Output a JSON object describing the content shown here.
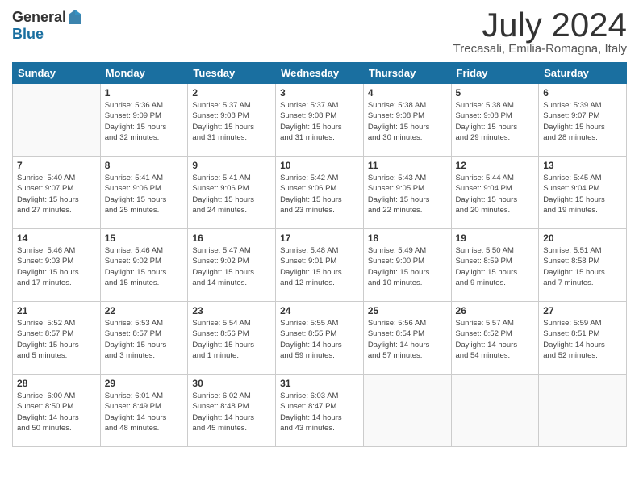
{
  "logo": {
    "general": "General",
    "blue": "Blue"
  },
  "title": "July 2024",
  "subtitle": "Trecasali, Emilia-Romagna, Italy",
  "days": [
    "Sunday",
    "Monday",
    "Tuesday",
    "Wednesday",
    "Thursday",
    "Friday",
    "Saturday"
  ],
  "weeks": [
    [
      {
        "num": "",
        "info": ""
      },
      {
        "num": "1",
        "info": "Sunrise: 5:36 AM\nSunset: 9:09 PM\nDaylight: 15 hours\nand 32 minutes."
      },
      {
        "num": "2",
        "info": "Sunrise: 5:37 AM\nSunset: 9:08 PM\nDaylight: 15 hours\nand 31 minutes."
      },
      {
        "num": "3",
        "info": "Sunrise: 5:37 AM\nSunset: 9:08 PM\nDaylight: 15 hours\nand 31 minutes."
      },
      {
        "num": "4",
        "info": "Sunrise: 5:38 AM\nSunset: 9:08 PM\nDaylight: 15 hours\nand 30 minutes."
      },
      {
        "num": "5",
        "info": "Sunrise: 5:38 AM\nSunset: 9:08 PM\nDaylight: 15 hours\nand 29 minutes."
      },
      {
        "num": "6",
        "info": "Sunrise: 5:39 AM\nSunset: 9:07 PM\nDaylight: 15 hours\nand 28 minutes."
      }
    ],
    [
      {
        "num": "7",
        "info": "Sunrise: 5:40 AM\nSunset: 9:07 PM\nDaylight: 15 hours\nand 27 minutes."
      },
      {
        "num": "8",
        "info": "Sunrise: 5:41 AM\nSunset: 9:06 PM\nDaylight: 15 hours\nand 25 minutes."
      },
      {
        "num": "9",
        "info": "Sunrise: 5:41 AM\nSunset: 9:06 PM\nDaylight: 15 hours\nand 24 minutes."
      },
      {
        "num": "10",
        "info": "Sunrise: 5:42 AM\nSunset: 9:06 PM\nDaylight: 15 hours\nand 23 minutes."
      },
      {
        "num": "11",
        "info": "Sunrise: 5:43 AM\nSunset: 9:05 PM\nDaylight: 15 hours\nand 22 minutes."
      },
      {
        "num": "12",
        "info": "Sunrise: 5:44 AM\nSunset: 9:04 PM\nDaylight: 15 hours\nand 20 minutes."
      },
      {
        "num": "13",
        "info": "Sunrise: 5:45 AM\nSunset: 9:04 PM\nDaylight: 15 hours\nand 19 minutes."
      }
    ],
    [
      {
        "num": "14",
        "info": "Sunrise: 5:46 AM\nSunset: 9:03 PM\nDaylight: 15 hours\nand 17 minutes."
      },
      {
        "num": "15",
        "info": "Sunrise: 5:46 AM\nSunset: 9:02 PM\nDaylight: 15 hours\nand 15 minutes."
      },
      {
        "num": "16",
        "info": "Sunrise: 5:47 AM\nSunset: 9:02 PM\nDaylight: 15 hours\nand 14 minutes."
      },
      {
        "num": "17",
        "info": "Sunrise: 5:48 AM\nSunset: 9:01 PM\nDaylight: 15 hours\nand 12 minutes."
      },
      {
        "num": "18",
        "info": "Sunrise: 5:49 AM\nSunset: 9:00 PM\nDaylight: 15 hours\nand 10 minutes."
      },
      {
        "num": "19",
        "info": "Sunrise: 5:50 AM\nSunset: 8:59 PM\nDaylight: 15 hours\nand 9 minutes."
      },
      {
        "num": "20",
        "info": "Sunrise: 5:51 AM\nSunset: 8:58 PM\nDaylight: 15 hours\nand 7 minutes."
      }
    ],
    [
      {
        "num": "21",
        "info": "Sunrise: 5:52 AM\nSunset: 8:57 PM\nDaylight: 15 hours\nand 5 minutes."
      },
      {
        "num": "22",
        "info": "Sunrise: 5:53 AM\nSunset: 8:57 PM\nDaylight: 15 hours\nand 3 minutes."
      },
      {
        "num": "23",
        "info": "Sunrise: 5:54 AM\nSunset: 8:56 PM\nDaylight: 15 hours\nand 1 minute."
      },
      {
        "num": "24",
        "info": "Sunrise: 5:55 AM\nSunset: 8:55 PM\nDaylight: 14 hours\nand 59 minutes."
      },
      {
        "num": "25",
        "info": "Sunrise: 5:56 AM\nSunset: 8:54 PM\nDaylight: 14 hours\nand 57 minutes."
      },
      {
        "num": "26",
        "info": "Sunrise: 5:57 AM\nSunset: 8:52 PM\nDaylight: 14 hours\nand 54 minutes."
      },
      {
        "num": "27",
        "info": "Sunrise: 5:59 AM\nSunset: 8:51 PM\nDaylight: 14 hours\nand 52 minutes."
      }
    ],
    [
      {
        "num": "28",
        "info": "Sunrise: 6:00 AM\nSunset: 8:50 PM\nDaylight: 14 hours\nand 50 minutes."
      },
      {
        "num": "29",
        "info": "Sunrise: 6:01 AM\nSunset: 8:49 PM\nDaylight: 14 hours\nand 48 minutes."
      },
      {
        "num": "30",
        "info": "Sunrise: 6:02 AM\nSunset: 8:48 PM\nDaylight: 14 hours\nand 45 minutes."
      },
      {
        "num": "31",
        "info": "Sunrise: 6:03 AM\nSunset: 8:47 PM\nDaylight: 14 hours\nand 43 minutes."
      },
      {
        "num": "",
        "info": ""
      },
      {
        "num": "",
        "info": ""
      },
      {
        "num": "",
        "info": ""
      }
    ]
  ]
}
